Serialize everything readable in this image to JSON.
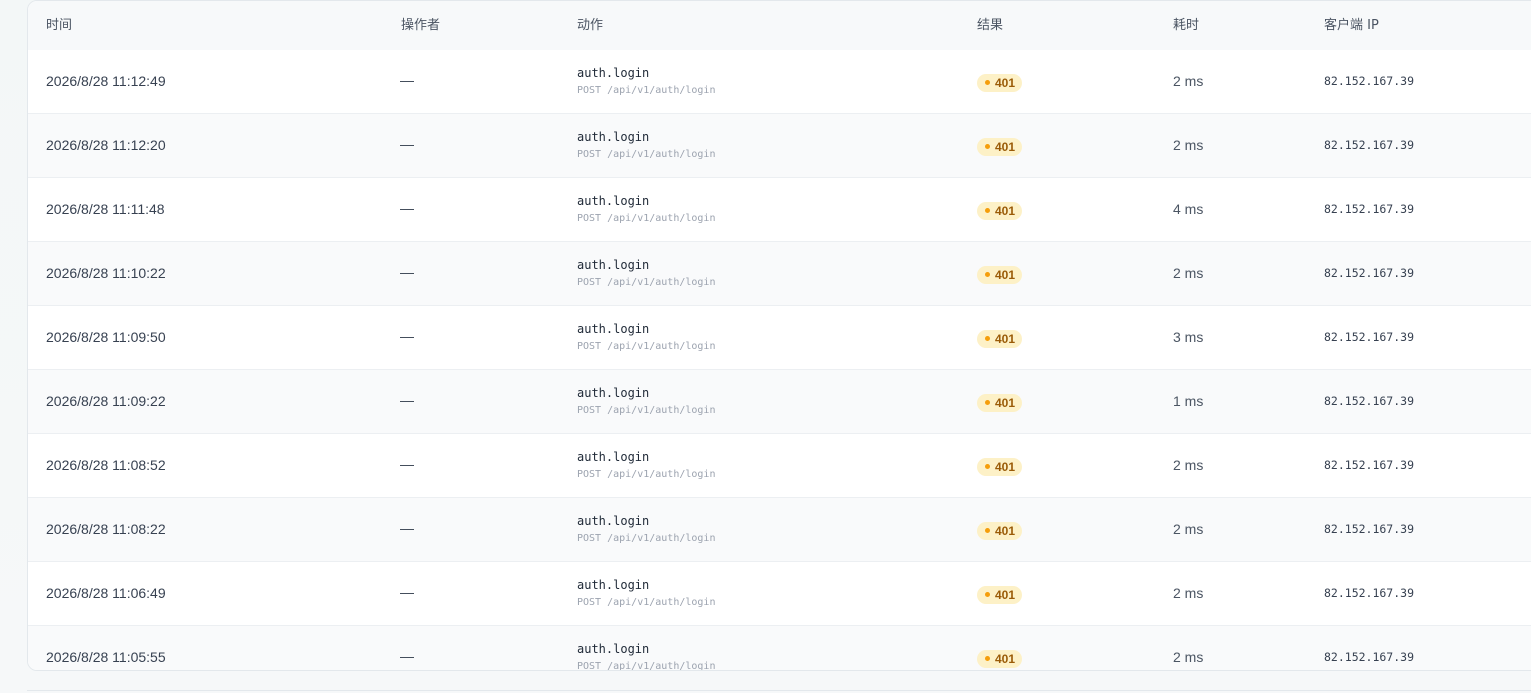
{
  "table": {
    "columns": {
      "time": "时间",
      "operator": "操作者",
      "action": "动作",
      "result": "结果",
      "duration": "耗时",
      "client_ip": "客户端 IP"
    },
    "rows": [
      {
        "time": "2026/8/28 11:12:49",
        "operator": "—",
        "action": "auth.login",
        "request": "POST /api/v1/auth/login",
        "result": "401",
        "duration": "2 ms",
        "ip": "82.152.167.39"
      },
      {
        "time": "2026/8/28 11:12:20",
        "operator": "—",
        "action": "auth.login",
        "request": "POST /api/v1/auth/login",
        "result": "401",
        "duration": "2 ms",
        "ip": "82.152.167.39"
      },
      {
        "time": "2026/8/28 11:11:48",
        "operator": "—",
        "action": "auth.login",
        "request": "POST /api/v1/auth/login",
        "result": "401",
        "duration": "4 ms",
        "ip": "82.152.167.39"
      },
      {
        "time": "2026/8/28 11:10:22",
        "operator": "—",
        "action": "auth.login",
        "request": "POST /api/v1/auth/login",
        "result": "401",
        "duration": "2 ms",
        "ip": "82.152.167.39"
      },
      {
        "time": "2026/8/28 11:09:50",
        "operator": "—",
        "action": "auth.login",
        "request": "POST /api/v1/auth/login",
        "result": "401",
        "duration": "3 ms",
        "ip": "82.152.167.39"
      },
      {
        "time": "2026/8/28 11:09:22",
        "operator": "—",
        "action": "auth.login",
        "request": "POST /api/v1/auth/login",
        "result": "401",
        "duration": "1 ms",
        "ip": "82.152.167.39"
      },
      {
        "time": "2026/8/28 11:08:52",
        "operator": "—",
        "action": "auth.login",
        "request": "POST /api/v1/auth/login",
        "result": "401",
        "duration": "2 ms",
        "ip": "82.152.167.39"
      },
      {
        "time": "2026/8/28 11:08:22",
        "operator": "—",
        "action": "auth.login",
        "request": "POST /api/v1/auth/login",
        "result": "401",
        "duration": "2 ms",
        "ip": "82.152.167.39"
      },
      {
        "time": "2026/8/28 11:06:49",
        "operator": "—",
        "action": "auth.login",
        "request": "POST /api/v1/auth/login",
        "result": "401",
        "duration": "2 ms",
        "ip": "82.152.167.39"
      },
      {
        "time": "2026/8/28 11:05:55",
        "operator": "—",
        "action": "auth.login",
        "request": "POST /api/v1/auth/login",
        "result": "401",
        "duration": "2 ms",
        "ip": "82.152.167.39"
      }
    ]
  },
  "colors": {
    "badge_bg": "#fdf1c7",
    "badge_text": "#9a5b07",
    "badge_dot": "#f59e0b",
    "header_bg": "#f7f9fa"
  }
}
